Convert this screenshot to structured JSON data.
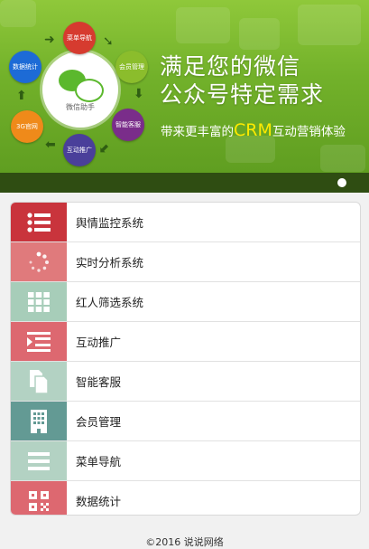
{
  "banner": {
    "headline_line1": "满足您的微信",
    "headline_line2": "公众号特定需求",
    "subline_prefix": "带来更丰富的",
    "subline_crm": "CRM",
    "subline_suffix": "互动营销体验",
    "hub_label": "微信助手",
    "nodes": [
      {
        "label": "菜单导航",
        "color": "#d63b2f"
      },
      {
        "label": "会员管理",
        "color": "#8bbd2c"
      },
      {
        "label": "智能客服",
        "color": "#7a2d8a"
      },
      {
        "label": "互动推广",
        "color": "#4a3f9a"
      },
      {
        "label": "3G官网",
        "color": "#ef8a1a"
      },
      {
        "label": "数据统计",
        "color": "#1d6bd6"
      }
    ],
    "carousel_active_index": 1
  },
  "menu": {
    "items": [
      {
        "label": "舆情监控系统",
        "icon": "list-icon",
        "color": "#c9343c"
      },
      {
        "label": "实时分析系统",
        "icon": "spinner-icon",
        "color": "#e07a7c"
      },
      {
        "label": "红人筛选系统",
        "icon": "grid-icon",
        "color": "#a7cdb9"
      },
      {
        "label": "互动推广",
        "icon": "indent-icon",
        "color": "#dd6870"
      },
      {
        "label": "智能客服",
        "icon": "documents-icon",
        "color": "#b3d2c3"
      },
      {
        "label": "会员管理",
        "icon": "building-icon",
        "color": "#639a94"
      },
      {
        "label": "菜单导航",
        "icon": "menu-icon",
        "color": "#b3d2c3"
      },
      {
        "label": "数据统计",
        "icon": "qrcode-icon",
        "color": "#dd6870"
      }
    ]
  },
  "footer": {
    "text": "©2016 说说网络"
  }
}
